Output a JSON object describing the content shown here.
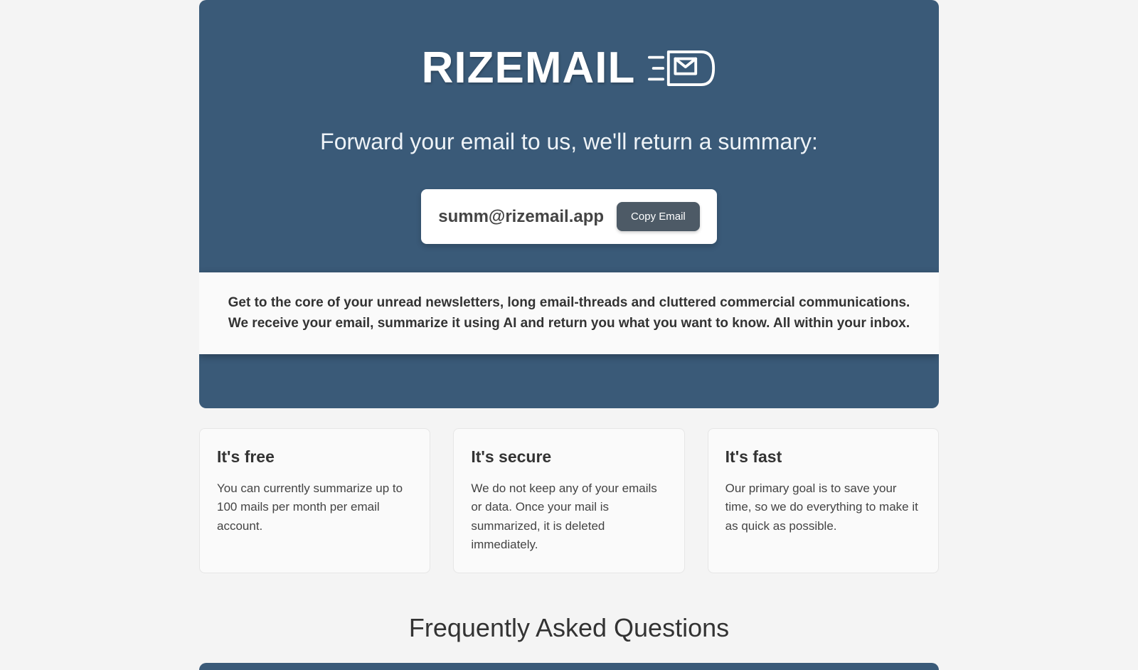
{
  "hero": {
    "brand": "RIZEMAIL",
    "tagline": "Forward your email to us, we'll return a summary:",
    "email": "summ@rizemail.app",
    "copy_label": "Copy Email",
    "description": "Get to the core of your unread newsletters, long email-threads and cluttered commercial communications. We receive your email, summarize it using AI and return you what you want to know. All within your inbox."
  },
  "features": [
    {
      "title": "It's free",
      "body": "You can currently summarize up to 100 mails per month per email account."
    },
    {
      "title": "It's secure",
      "body": "We do not keep any of your emails or data. Once your mail is summarized, it is deleted immediately."
    },
    {
      "title": "It's fast",
      "body": "Our primary goal is to save your time, so we do everything to make it as quick as possible."
    }
  ],
  "faq": {
    "heading": "Frequently Asked Questions"
  }
}
